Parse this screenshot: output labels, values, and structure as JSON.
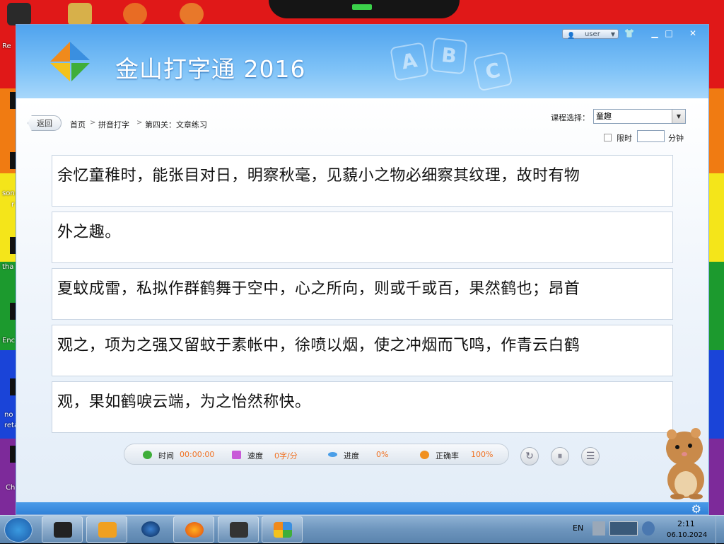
{
  "app": {
    "title": "金山打字通 2016",
    "abc_letters": [
      "A",
      "B",
      "C"
    ],
    "user_label": "user"
  },
  "nav": {
    "back_label": "返回",
    "breadcrumb": [
      "首页",
      "拼音打字",
      "第四关：文章练习"
    ],
    "separator": ">"
  },
  "course": {
    "label": "课程选择：",
    "selected": "童趣"
  },
  "limit": {
    "label": "限时",
    "value": "",
    "unit": "分钟"
  },
  "lines": [
    "余忆童稚时，能张目对日，明察秋毫，见藐小之物必细察其纹理，故时有物",
    "外之趣。",
    "夏蚊成雷，私拟作群鹤舞于空中，心之所向，则或千或百，果然鹤也；昂首",
    "观之，项为之强又留蚊于素帐中，徐喷以烟，使之冲烟而飞鸣，作青云白鹤",
    "观，果如鹤唳云端，为之怡然称快。"
  ],
  "stats": {
    "time_label": "时间",
    "time_value": "00:00:00",
    "speed_label": "速度",
    "speed_value": "0字/分",
    "progress_label": "进度",
    "progress_value": "0%",
    "accuracy_label": "正确率",
    "accuracy_value": "100%"
  },
  "desktop_labels": [
    "Re",
    "son",
    "r",
    "tha",
    "Enc",
    "no",
    "reta",
    "Ch"
  ],
  "taskbar": {
    "lang": "EN",
    "time": "2:11",
    "date": "06.10.2024"
  },
  "colors": {
    "accent": "#4fa3ee",
    "stat_value": "#f07020",
    "footer": "#2f7fd6"
  },
  "icons": [
    "windows-start-icon",
    "terminal-icon",
    "media-player-icon",
    "globe-icon",
    "firefox-icon",
    "monitor-icon",
    "typing-app-icon",
    "gear-icon"
  ]
}
